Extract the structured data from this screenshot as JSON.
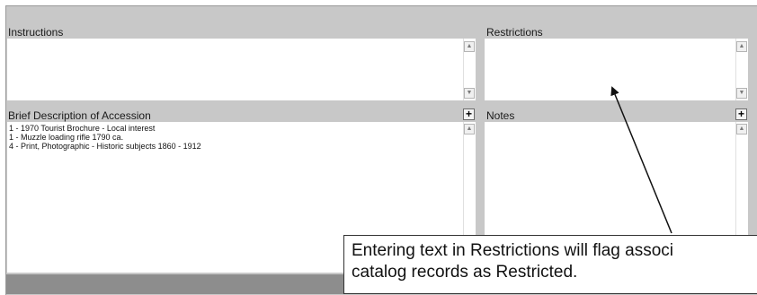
{
  "instructions": {
    "label": "Instructions",
    "value": ""
  },
  "restrictions": {
    "label": "Restrictions",
    "value": ""
  },
  "brief_description": {
    "label": "Brief Description of Accession",
    "add_label": "+",
    "items": [
      "1 - 1970 Tourist Brochure - Local interest",
      "1 - Muzzle loading rifle 1790 ca.",
      "4 - Print, Photographic - Historic subjects 1860 - 1912"
    ]
  },
  "notes": {
    "label": "Notes",
    "add_label": "+",
    "value": ""
  },
  "callout": {
    "line1": "Entering text in Restrictions will flag associ",
    "line2": "catalog records as Restricted."
  },
  "icons": {
    "scroll_up": "up-arrow-icon",
    "scroll_down": "down-arrow-icon",
    "add": "plus-icon"
  }
}
